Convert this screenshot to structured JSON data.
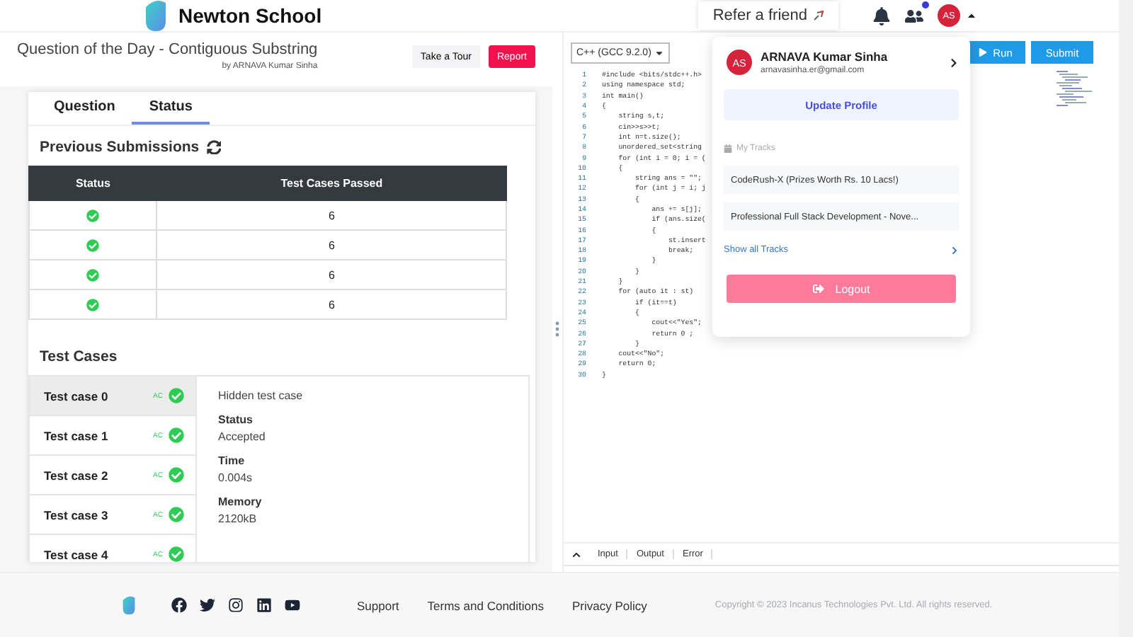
{
  "header": {
    "logo_text": "Newton School",
    "refer_button": "Refer a friend",
    "people_badge": true,
    "avatar": "AS"
  },
  "question": {
    "title": "Question of the Day - Contiguous Substring",
    "author": "by ARNAVA Kumar Sinha",
    "tour_button": "Take a Tour",
    "report_button": "Report"
  },
  "tabs": [
    {
      "label": "Question",
      "selected": false
    },
    {
      "label": "Status",
      "selected": true
    }
  ],
  "submissions": {
    "title": "Previous Submissions",
    "columns": [
      "Status",
      "Test Cases Passed"
    ],
    "rows": [
      {
        "accepted": true,
        "passed": "6"
      },
      {
        "accepted": true,
        "passed": "6"
      },
      {
        "accepted": true,
        "passed": "6"
      },
      {
        "accepted": true,
        "passed": "6"
      }
    ]
  },
  "test_cases": {
    "title": "Test Cases",
    "items": [
      {
        "label": "Test case 0",
        "verdict": "AC",
        "accepted": true,
        "selected": true
      },
      {
        "label": "Test case 1",
        "verdict": "AC",
        "accepted": true,
        "selected": false
      },
      {
        "label": "Test case 2",
        "verdict": "AC",
        "accepted": true,
        "selected": false
      },
      {
        "label": "Test case 3",
        "verdict": "AC",
        "accepted": true,
        "selected": false
      },
      {
        "label": "Test case 4",
        "verdict": "AC",
        "accepted": true,
        "selected": false
      }
    ],
    "detail": {
      "note": "Hidden test case",
      "fields": [
        {
          "label": "Status",
          "value": "Accepted"
        },
        {
          "label": "Time",
          "value": "0.004s"
        },
        {
          "label": "Memory",
          "value": "2120kB"
        }
      ]
    }
  },
  "editor": {
    "language": "C++ (GCC 9.2.0)",
    "run_button": "Run",
    "submit_button": "Submit",
    "lines": [
      {
        "n": "1",
        "code": "#include <bits/stdc++.h>"
      },
      {
        "n": "2",
        "code": "using namespace std;"
      },
      {
        "n": "3",
        "code": "int main()"
      },
      {
        "n": "4",
        "code": "{"
      },
      {
        "n": "5",
        "code": "    string s,t;"
      },
      {
        "n": "6",
        "code": "    cin>>s>>t;"
      },
      {
        "n": "7",
        "code": "    int n=t.size();"
      },
      {
        "n": "8",
        "code": "    unordered_set<string"
      },
      {
        "n": "9",
        "code": "    for (int i = 0; i = ("
      },
      {
        "n": "10",
        "code": "    {"
      },
      {
        "n": "11",
        "code": "        string ans = \"\";"
      },
      {
        "n": "12",
        "code": "        for (int j = i; j"
      },
      {
        "n": "13",
        "code": "        {"
      },
      {
        "n": "14",
        "code": "            ans += s[j];"
      },
      {
        "n": "15",
        "code": "            if (ans.size("
      },
      {
        "n": "16",
        "code": "            {"
      },
      {
        "n": "17",
        "code": "                st.insert"
      },
      {
        "n": "18",
        "code": "                break;"
      },
      {
        "n": "19",
        "code": "            }"
      },
      {
        "n": "20",
        "code": "        }"
      },
      {
        "n": "21",
        "code": "    }"
      },
      {
        "n": "22",
        "code": "    for (auto it : st)"
      },
      {
        "n": "23",
        "code": "        if (it==t)"
      },
      {
        "n": "24",
        "code": "        {"
      },
      {
        "n": "25",
        "code": "            cout<<\"Yes\";"
      },
      {
        "n": "26",
        "code": "            return 0 ;"
      },
      {
        "n": "27",
        "code": "        }"
      },
      {
        "n": "28",
        "code": "    cout<<\"No\";"
      },
      {
        "n": "29",
        "code": "    return 0;"
      },
      {
        "n": "30",
        "code": "}"
      }
    ],
    "bottom_tabs": [
      "Input",
      "Output",
      "Error"
    ]
  },
  "profile_menu": {
    "avatar": "AS",
    "name": "ARNAVA Kumar Sinha",
    "email": "arnavasinha.er@gmail.com",
    "update_button": "Update Profile",
    "tracks_title": "My Tracks",
    "tracks": [
      "CodeRush-X (Prizes Worth Rs. 10 Lacs!)",
      "Professional Full Stack Development - Nove..."
    ],
    "show_all": "Show all Tracks",
    "logout_button": "Logout"
  },
  "footer": {
    "links": [
      "Support",
      "Terms and Conditions",
      "Privacy Policy"
    ],
    "copyright": "Copyright © 2023 Incanus Technologies Pvt. Ltd. All rights reserved."
  }
}
